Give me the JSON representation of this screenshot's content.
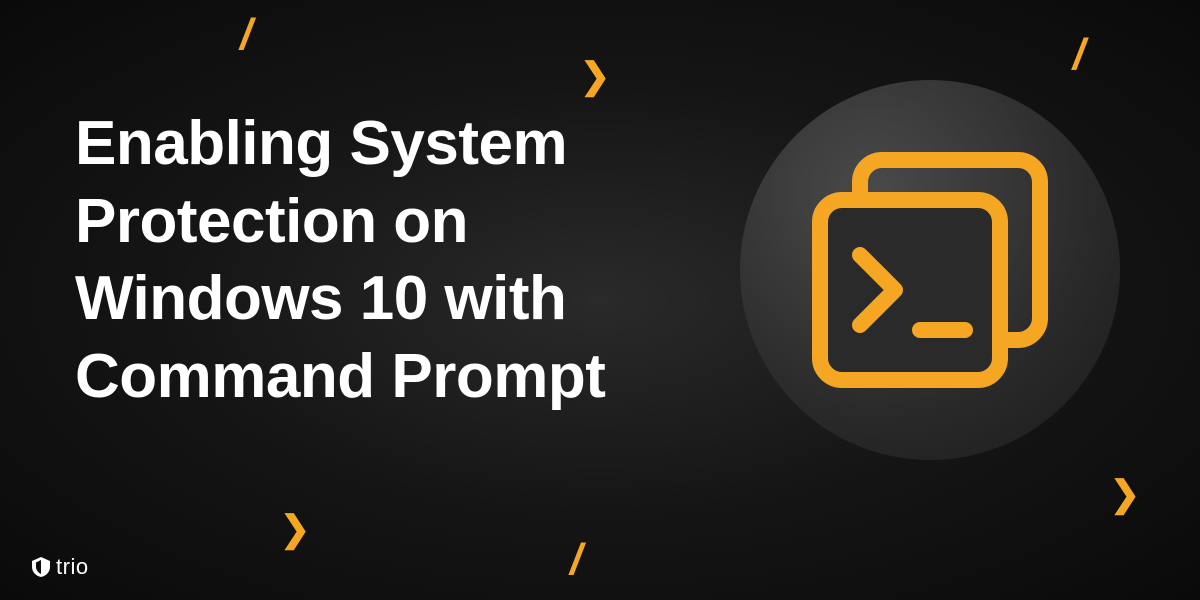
{
  "title": "Enabling System\nProtection on\nWindows 10 with\nCommand Prompt",
  "brand": {
    "name": "trio"
  },
  "colors": {
    "accent": "#f5a623",
    "text": "#ffffff",
    "bg_dark": "#0a0a0a"
  },
  "decorations": {
    "arrow_glyph": "❯",
    "slash_glyph": "/"
  }
}
